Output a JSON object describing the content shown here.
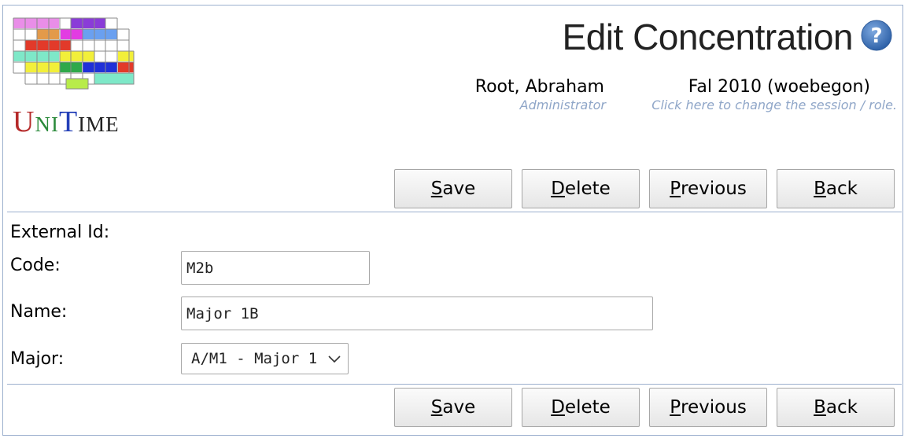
{
  "header": {
    "title": "Edit Concentration",
    "user_name": "Root, Abraham",
    "user_role": "Administrator",
    "session_name": "Fal 2010 (woebegon)",
    "session_hint": "Click here to change the session / role."
  },
  "logo": {
    "text_u": "U",
    "text_ni": "NI",
    "text_t": "T",
    "text_ime": "IME"
  },
  "buttons": {
    "save": {
      "accel": "S",
      "rest": "ave"
    },
    "delete": {
      "accel": "D",
      "rest": "elete"
    },
    "previous": {
      "accel": "P",
      "rest": "revious"
    },
    "back": {
      "accel": "B",
      "rest": "ack"
    }
  },
  "form": {
    "external_id_label": "External Id:",
    "code_label": "Code:",
    "code_value": "M2b",
    "name_label": "Name:",
    "name_value": "Major 1B",
    "major_label": "Major:",
    "major_value": "A/M1 - Major 1"
  },
  "colors": {
    "border": "#9cb0ce",
    "hint": "#8fa6c8",
    "help_icon": "#3f73b5"
  }
}
